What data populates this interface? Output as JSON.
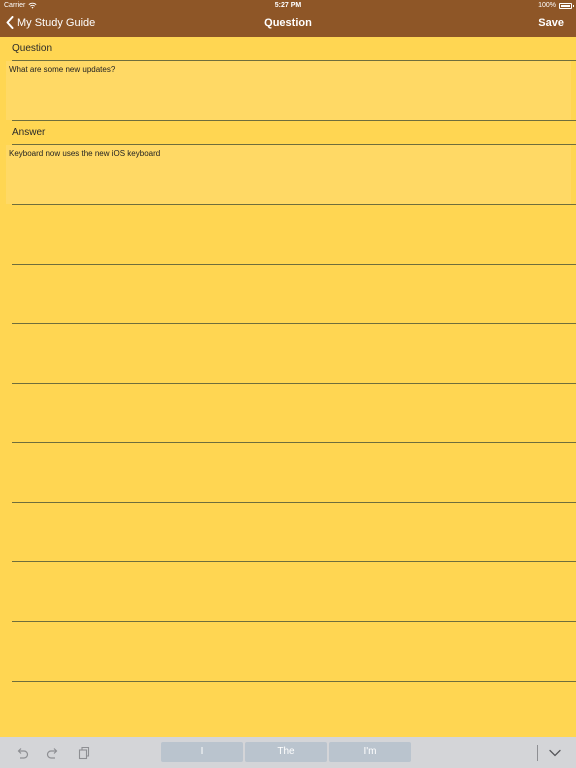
{
  "status_bar": {
    "carrier": "Carrier",
    "time": "5:27 PM",
    "battery_percent": "100%"
  },
  "nav": {
    "back_label": "My Study Guide",
    "title": "Question",
    "save_label": "Save"
  },
  "question": {
    "label": "Question",
    "value": "What are some new updates?"
  },
  "answer": {
    "label": "Answer",
    "value": "Keyboard now uses the new iOS keyboard"
  },
  "keyboard_bar": {
    "suggestions": [
      "I",
      "The",
      "I'm"
    ]
  },
  "colors": {
    "nav_background": "#8E5627",
    "page_background": "#FFD652",
    "field_background": "#FFD965",
    "rule_color": "#6f6e3c",
    "suggestion_background": "#BAC4CE"
  },
  "icons": {
    "back": "chevron-left-icon",
    "undo": "undo-icon",
    "redo": "redo-icon",
    "paste": "paste-icon",
    "dismiss": "chevron-down-icon",
    "wifi": "wifi-icon",
    "battery": "battery-icon"
  }
}
